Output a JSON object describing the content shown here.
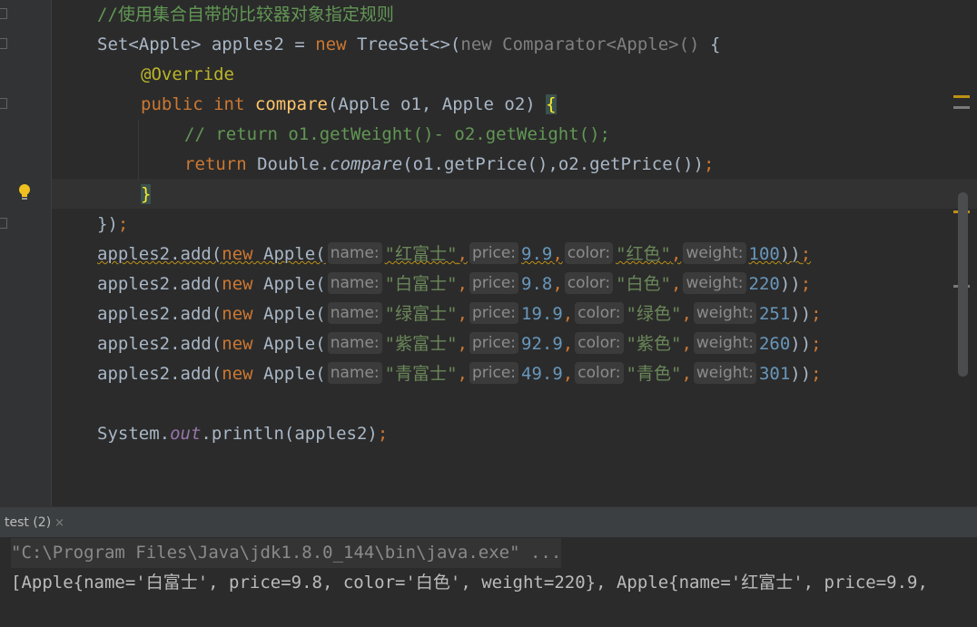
{
  "editor": {
    "comment_line": "//使用集合自带的比较器对象指定规则",
    "line1": {
      "a": "Set<Apple> apples2 = ",
      "new": "new",
      "b": " TreeSet<>(",
      "c": "new Comparator<Apple>()",
      "d": " {"
    },
    "annotation": "@Override",
    "line3": {
      "kw1": "public",
      "kw2": "int",
      "fn": "compare",
      "rest": "(Apple o1, Apple o2) ",
      "brace": "{"
    },
    "line4": "// return o1.getWeight()- o2.getWeight();",
    "line5": {
      "kw": "return",
      "a": " Double.",
      "method": "compare",
      "b": "(o1.getPrice(),o2.getPrice())",
      "semi": ";"
    },
    "close_brace": "}",
    "close_paren": "})",
    "semicolon": ";",
    "add_prefix": "apples2.add(",
    "new_kw": "new",
    "apple_ctor": " Apple(",
    "hints": {
      "name": "name:",
      "price": "price:",
      "color": "color:",
      "weight": "weight:"
    },
    "apples": [
      {
        "name": "\"红富士\"",
        "price": "9.9",
        "color": "\"红色\"",
        "weight": "100"
      },
      {
        "name": "\"白富士\"",
        "price": "9.8",
        "color": "\"白色\"",
        "weight": "220"
      },
      {
        "name": "\"绿富士\"",
        "price": "19.9",
        "color": "\"绿色\"",
        "weight": "251"
      },
      {
        "name": "\"紫富士\"",
        "price": "92.9",
        "color": "\"紫色\"",
        "weight": "260"
      },
      {
        "name": "\"青富士\"",
        "price": "49.9",
        "color": "\"青色\"",
        "weight": "301"
      }
    ],
    "println": {
      "a": "System.",
      "out": "out",
      "b": ".println(apples2)",
      "semi": ";"
    }
  },
  "run_panel": {
    "tab_label": "test (2)",
    "close_glyph": "×"
  },
  "console": {
    "command": "\"C:\\Program Files\\Java\\jdk1.8.0_144\\bin\\java.exe\" ...",
    "output": "[Apple{name='白富士', price=9.8, color='白色', weight=220}, Apple{name='红富士', price=9.9,"
  },
  "icons": {
    "bulb": "lightbulb-icon",
    "close": "close-icon"
  },
  "colors": {
    "background": "#2b2b2b",
    "keyword": "#cc7832",
    "string": "#6a8759",
    "number": "#6897bb",
    "comment": "#629755",
    "function": "#ffc66d",
    "annotation": "#bbb529"
  }
}
